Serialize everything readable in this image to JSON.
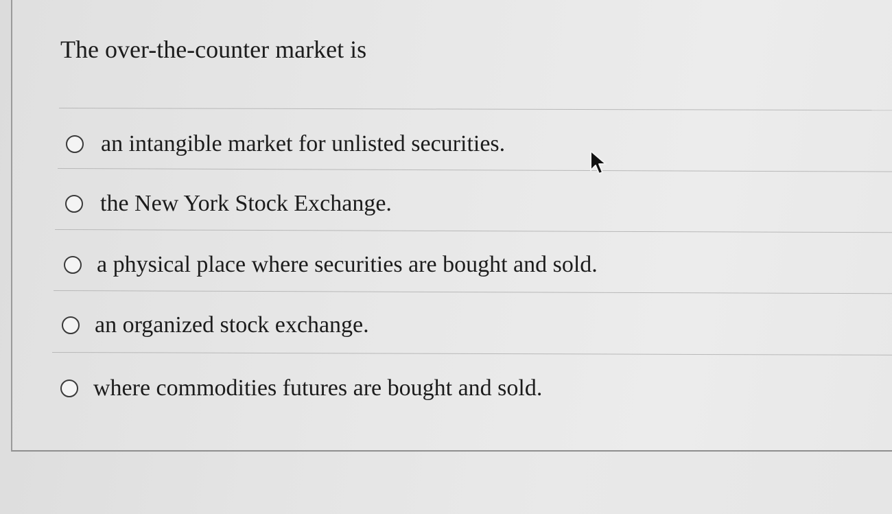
{
  "question": {
    "text": "The over-the-counter market is"
  },
  "options": [
    {
      "label": "an intangible market for unlisted securities.",
      "selected": false
    },
    {
      "label": "the New York Stock Exchange.",
      "selected": false
    },
    {
      "label": "a physical place where securities are bought and sold.",
      "selected": false
    },
    {
      "label": "an organized stock exchange.",
      "selected": false
    },
    {
      "label": "where commodities futures are bought and sold.",
      "selected": false
    }
  ],
  "icons": {
    "radio": "radio-button-icon",
    "pointer": "mouse-pointer-icon"
  }
}
